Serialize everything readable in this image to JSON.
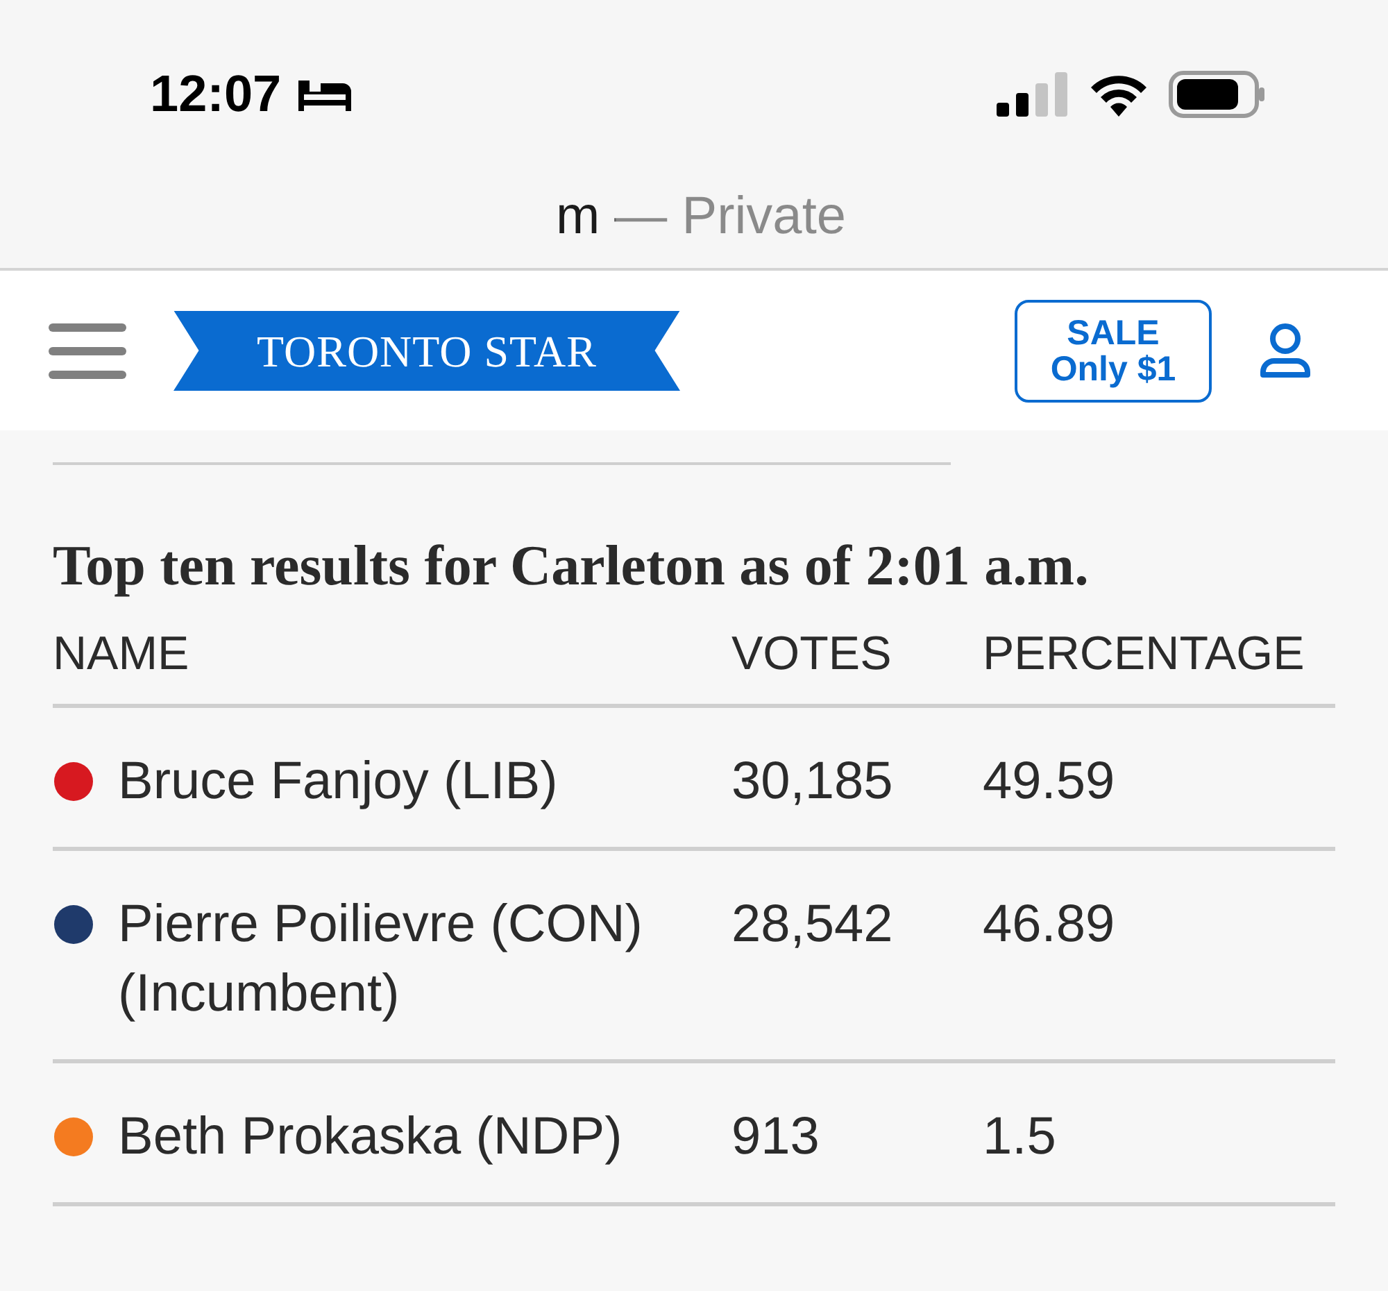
{
  "status_bar": {
    "time": "12:07"
  },
  "browser": {
    "address": "m — Private"
  },
  "header": {
    "logo": "TORONTO STAR",
    "sale_button": [
      "SALE",
      "Only $1"
    ]
  },
  "results": {
    "title": "Top ten results for Carleton as of 2:01 a.m.",
    "columns": [
      "NAME",
      "VOTES",
      "PERCENTAGE"
    ],
    "rows": [
      {
        "name": "Bruce Fanjoy (LIB)",
        "votes": "30,185",
        "percentage": "49.59",
        "color": "#d71920"
      },
      {
        "name": "Pierre Poilievre (CON) (Incumbent)",
        "votes": "28,542",
        "percentage": "46.89",
        "color": "#1f3a6b"
      },
      {
        "name": "Beth Prokaska (NDP)",
        "votes": "913",
        "percentage": "1.5",
        "color": "#f47b20"
      }
    ]
  }
}
